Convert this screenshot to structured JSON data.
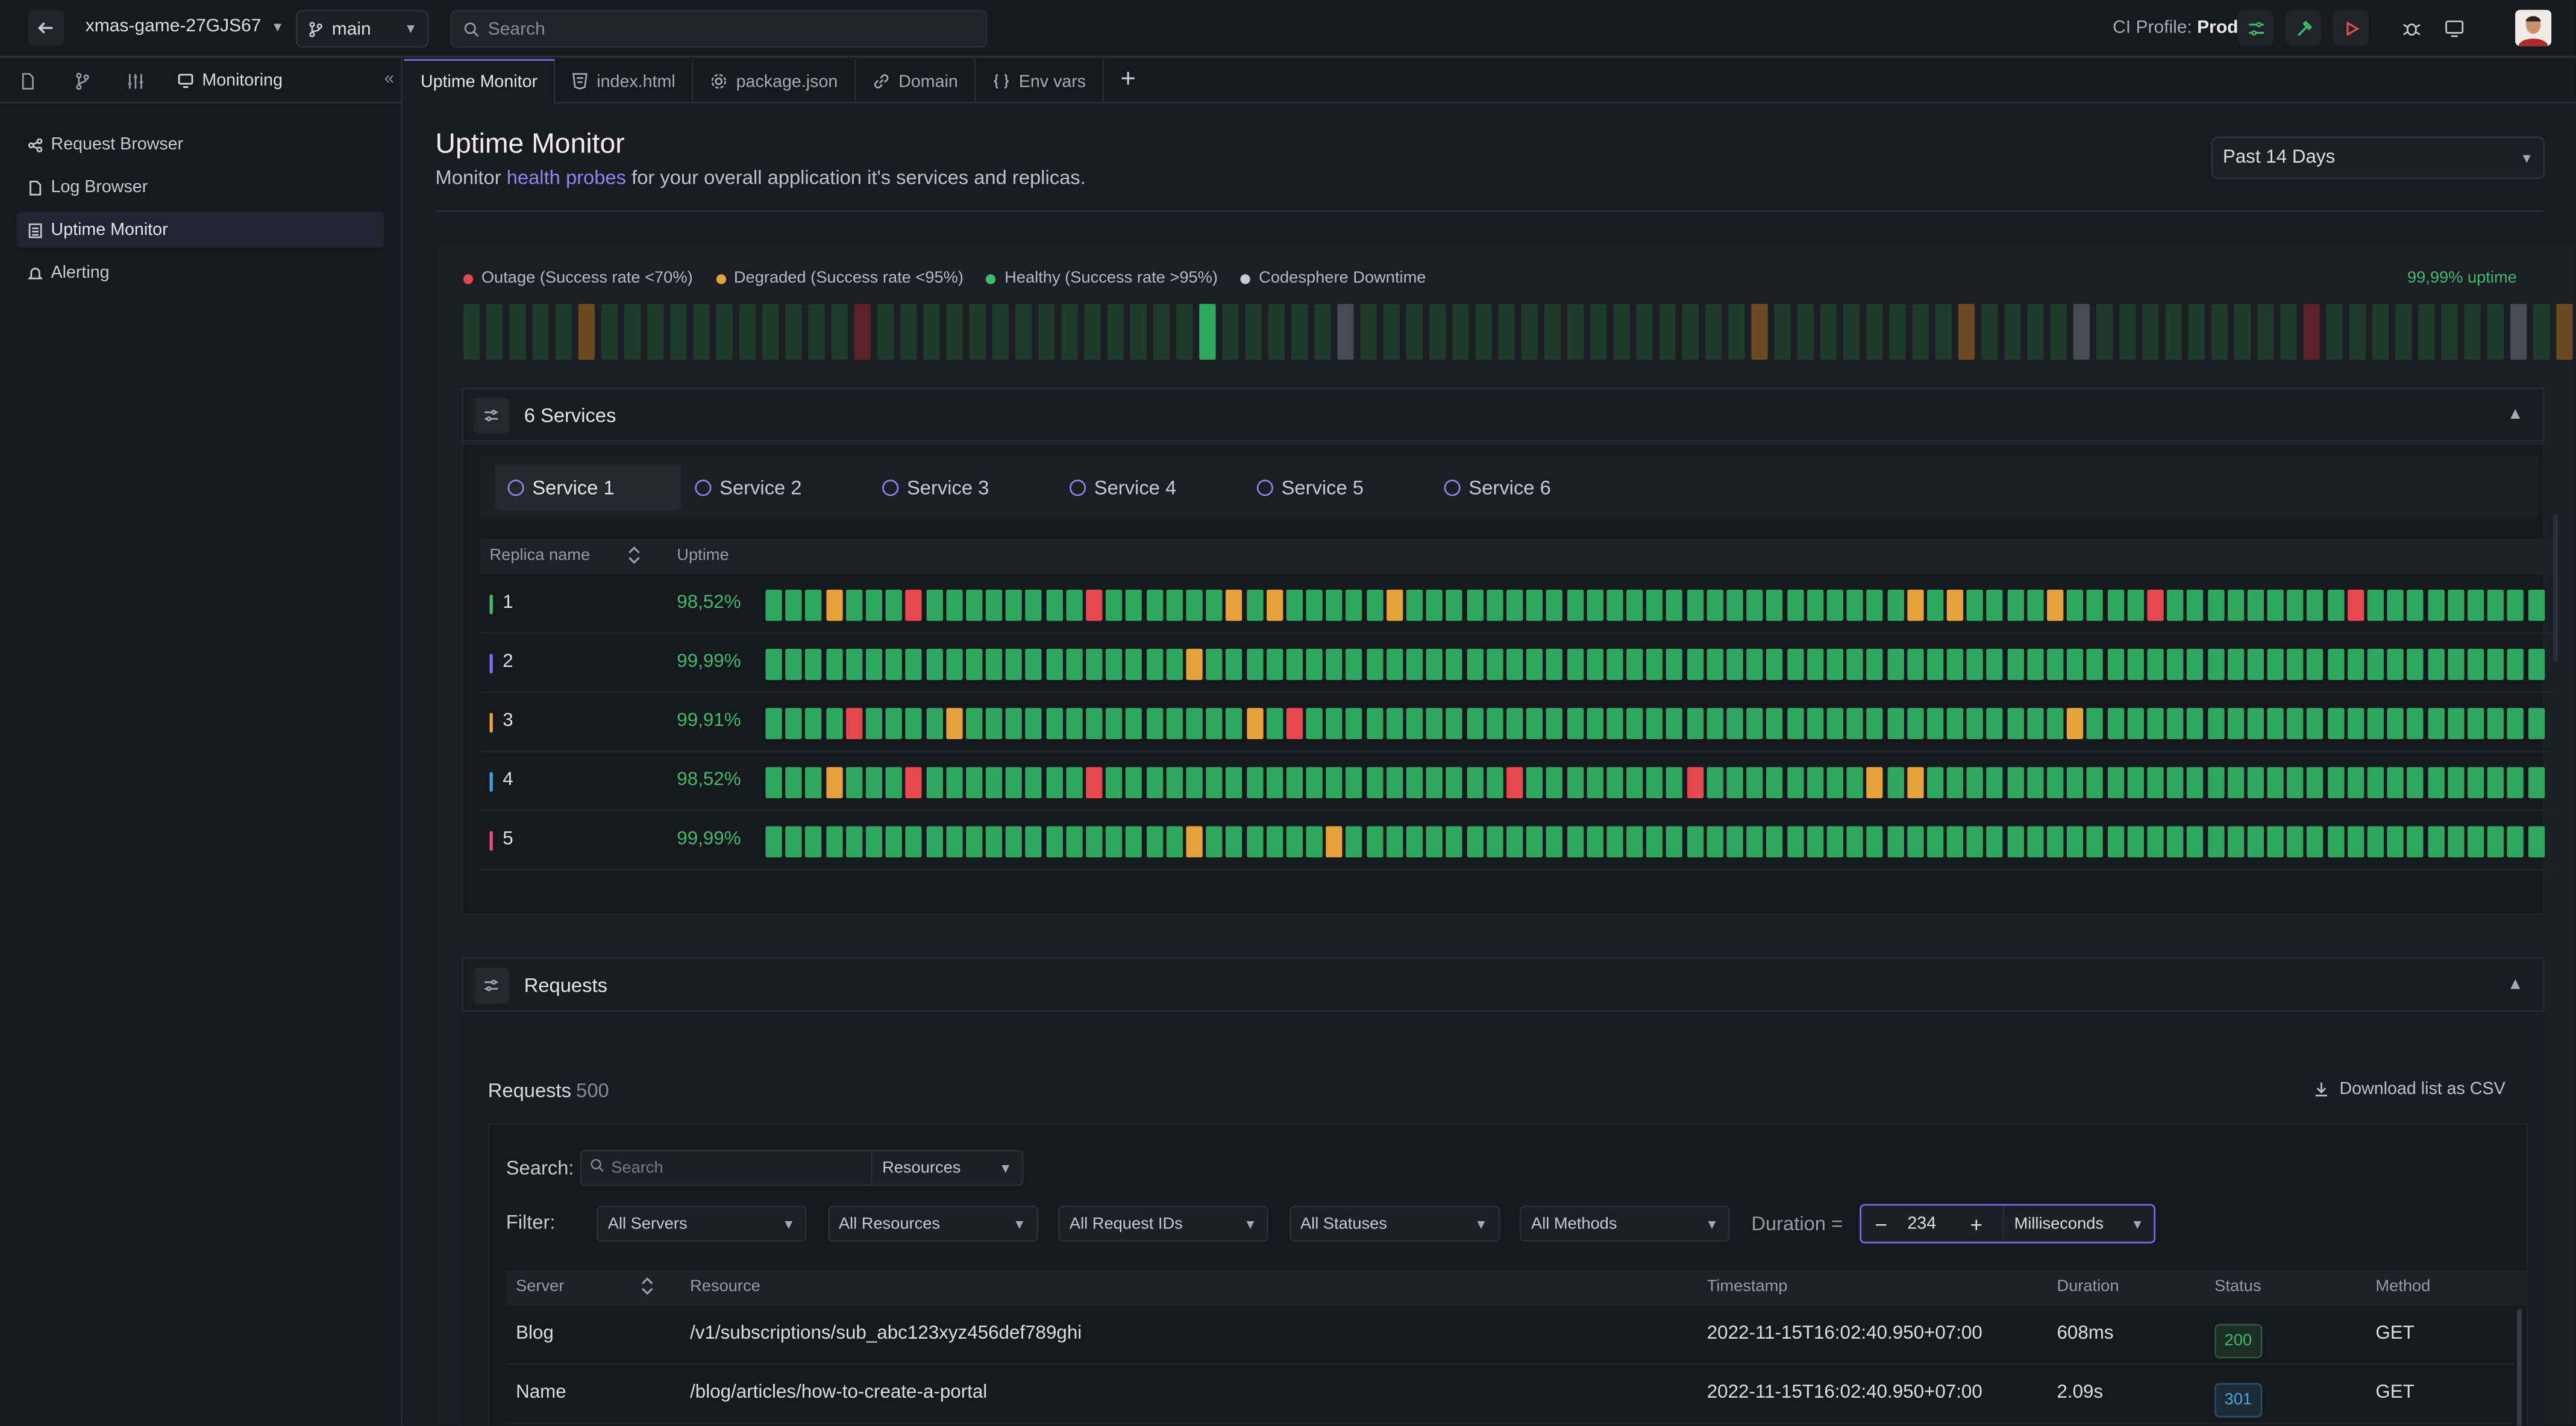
{
  "topbar": {
    "project": "xmas-game-27GJS67",
    "branch": "main",
    "search_placeholder": "Search",
    "ci_label": "CI Profile:",
    "ci_value": "Prod"
  },
  "sidebar": {
    "tab_monitoring": "Monitoring",
    "items": [
      {
        "label": "Request Browser",
        "icon": "share-icon"
      },
      {
        "label": "Log Browser",
        "icon": "file-icon"
      },
      {
        "label": "Uptime Monitor",
        "icon": "monitor-list-icon",
        "active": true
      },
      {
        "label": "Alerting",
        "icon": "bell-icon"
      }
    ]
  },
  "tabs": [
    {
      "label": "Uptime Monitor",
      "icon": ""
    },
    {
      "label": "index.html",
      "icon": "html5-icon"
    },
    {
      "label": "package.json",
      "icon": "gear-icon"
    },
    {
      "label": "Domain",
      "icon": "link-icon"
    },
    {
      "label": "Env vars",
      "icon": "braces-icon"
    }
  ],
  "page": {
    "title": "Uptime Monitor",
    "subtitle_pre": "Monitor ",
    "subtitle_link": "health probes",
    "subtitle_post": " for your overall application it's services and replicas.",
    "range": "Past 14 Days"
  },
  "legend": [
    {
      "label": "Outage (Success rate <70%)",
      "color": "#e5484d"
    },
    {
      "label": "Degraded (Success rate <95%)",
      "color": "#e5a13a"
    },
    {
      "label": "Healthy (Success rate >95%)",
      "color": "#3fb96a"
    },
    {
      "label": "Codesphere Downtime",
      "color": "#c8c8d2"
    }
  ],
  "overall_uptime": "99,99% uptime",
  "overview_bars": "gggggOgggggggggggRggggggggggggggGgggggDgggggggggggggggggOggggggggOggggDgggggggggRggggggggDgOggg",
  "services_panel": {
    "title": "6 Services",
    "tabs": [
      "Service 1",
      "Service 2",
      "Service 3",
      "Service 4",
      "Service 5",
      "Service 6"
    ]
  },
  "replica_table": {
    "col_name": "Replica name",
    "col_uptime": "Uptime",
    "rows": [
      {
        "name": "1",
        "uptime": "98,52%",
        "color": "#3fb96a",
        "bars": "gggogggrggggggggrggggggogogggggogggggggggggggggggggggggggogoggggoggggrgggggggggrgggggggggogog"
      },
      {
        "name": "2",
        "uptime": "99,99%",
        "color": "#7a6cf0",
        "bars": "gggggggggggggggggggggogggggggggggggggggggggggggggggggggggggggggggggggggggggggggggggggggggggggg"
      },
      {
        "name": "3",
        "uptime": "99,91%",
        "color": "#e5a13a",
        "bars": "ggggrggggoggggggggggggggogrggggggggggggggggggggggggggggggggggggggogggggggggggggggggggggggggggg"
      },
      {
        "name": "4",
        "uptime": "98,52%",
        "color": "#3b9fd6",
        "bars": "gggogggrggggggggrggggggggggggggggggggrggggggggrggggggggogogggggggggggggggggggggggggggggggggogog"
      },
      {
        "name": "5",
        "uptime": "99,99%",
        "color": "#e04a8a",
        "bars": "gggggggggggggggggggggoggggggoggggggggggggggggggggggggggggggggggggggggggggggggggggggggggggggggg"
      }
    ]
  },
  "requests_panel": {
    "title": "Requests"
  },
  "requests": {
    "title": "Requests",
    "count": "500",
    "download": "Download list as CSV",
    "search_label": "Search:",
    "search_placeholder": "Search",
    "search_scope": "Resources",
    "filter_label": "Filter:",
    "filters": [
      "All Servers",
      "All Resources",
      "All Request IDs",
      "All Statuses",
      "All Methods"
    ],
    "duration_label": "Duration =",
    "duration_value": "234",
    "duration_unit": "Milliseconds",
    "columns": [
      "Server",
      "Resource",
      "Timestamp",
      "Duration",
      "Status",
      "Method"
    ],
    "rows": [
      {
        "server": "Blog",
        "resource": "/v1/subscriptions/sub_abc123xyz456def789ghi",
        "timestamp": "2022-11-15T16:02:40.950+07:00",
        "duration": "608ms",
        "status": "200",
        "method": "GET"
      },
      {
        "server": "Name",
        "resource": "/blog/articles/how-to-create-a-portal",
        "timestamp": "2022-11-15T16:02:40.950+07:00",
        "duration": "2.09s",
        "status": "301",
        "method": "GET"
      }
    ]
  }
}
